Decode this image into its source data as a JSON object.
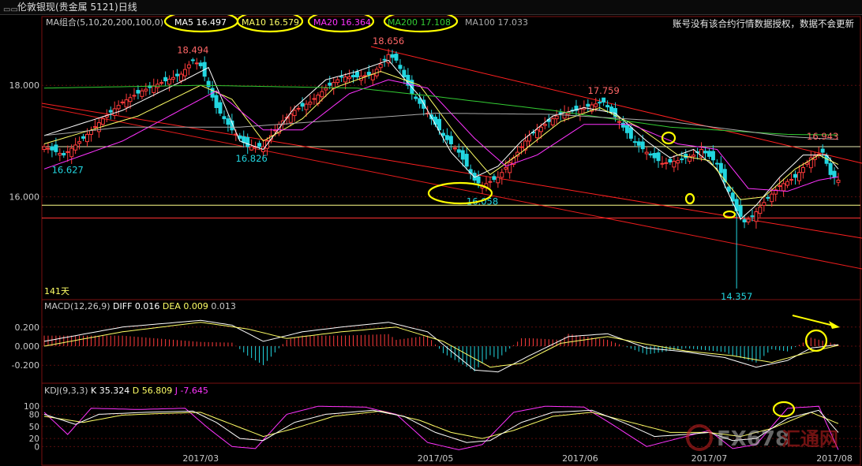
{
  "window": {
    "icon": "window-icon",
    "title": "伦敦银现(贵金属 5121)日线",
    "notice": "账号没有该合约行情数据授权，数据不会更新",
    "days_label": "141天"
  },
  "watermark": {
    "brand": "FX678",
    "cn": "汇通网"
  },
  "colors": {
    "bg": "#000000",
    "up": "#ff3b3b",
    "down": "#22d6e0",
    "ma5": "#ffffff",
    "ma10": "#ffff66",
    "ma20": "#ff33ff",
    "ma200": "#33cc33",
    "ma100": "#aaaaaa",
    "highlight": "#ffff00",
    "trend": "#ff2020"
  },
  "chart_data": [
    {
      "type": "candlestick",
      "panel": "price",
      "indicator_label": "MA组合(5,10,20,200,100,0)",
      "legend": [
        {
          "name": "MA5",
          "value": "16.497"
        },
        {
          "name": "MA10",
          "value": "16.579"
        },
        {
          "name": "MA20",
          "value": "16.364"
        },
        {
          "name": "MA200",
          "value": "17.108"
        },
        {
          "name": "MA100",
          "value": "17.033"
        }
      ],
      "ylim": [
        14.2,
        18.95
      ],
      "y_ticks": [
        "18.000",
        "16.000"
      ],
      "x_ticks": [
        "2017/03",
        "2017/05",
        "2017/06",
        "2017/07",
        "2017/08"
      ],
      "annotations": [
        {
          "text": "18.494",
          "value": 18.494
        },
        {
          "text": "18.656",
          "value": 18.656
        },
        {
          "text": "17.759",
          "value": 17.759
        },
        {
          "text": "16.943",
          "value": 16.943
        },
        {
          "text": "16.627",
          "value": 16.627
        },
        {
          "text": "16.826",
          "value": 16.826
        },
        {
          "text": "16.058",
          "value": 16.058
        },
        {
          "text": "14.357",
          "value": 14.357
        }
      ],
      "horizontal_levels": [
        16.9,
        15.85,
        15.62
      ],
      "ma_knots": {
        "ma5": [
          [
            0,
            17.1
          ],
          [
            20,
            17.55
          ],
          [
            36,
            18.1
          ],
          [
            42,
            18.32
          ],
          [
            50,
            17.0
          ],
          [
            56,
            16.85
          ],
          [
            64,
            17.6
          ],
          [
            72,
            18.1
          ],
          [
            80,
            18.25
          ],
          [
            88,
            18.45
          ],
          [
            96,
            17.8
          ],
          [
            104,
            16.8
          ],
          [
            110,
            16.35
          ],
          [
            116,
            16.55
          ],
          [
            122,
            17.0
          ],
          [
            130,
            17.45
          ],
          [
            138,
            17.6
          ],
          [
            146,
            17.5
          ],
          [
            154,
            17.0
          ],
          [
            160,
            16.7
          ],
          [
            166,
            16.85
          ],
          [
            172,
            16.5
          ],
          [
            176,
            15.9
          ],
          [
            178,
            15.6
          ],
          [
            182,
            15.85
          ],
          [
            188,
            16.35
          ],
          [
            194,
            16.75
          ],
          [
            200,
            16.75
          ],
          [
            203,
            16.5
          ]
        ],
        "ma10": [
          [
            0,
            16.95
          ],
          [
            24,
            17.45
          ],
          [
            40,
            18.0
          ],
          [
            48,
            17.75
          ],
          [
            56,
            17.0
          ],
          [
            66,
            17.4
          ],
          [
            74,
            17.95
          ],
          [
            86,
            18.25
          ],
          [
            96,
            18.0
          ],
          [
            106,
            17.05
          ],
          [
            114,
            16.4
          ],
          [
            122,
            16.8
          ],
          [
            132,
            17.35
          ],
          [
            142,
            17.6
          ],
          [
            152,
            17.25
          ],
          [
            162,
            16.75
          ],
          [
            170,
            16.65
          ],
          [
            178,
            15.95
          ],
          [
            184,
            16.0
          ],
          [
            192,
            16.5
          ],
          [
            198,
            16.75
          ],
          [
            203,
            16.58
          ]
        ],
        "ma20": [
          [
            0,
            16.5
          ],
          [
            20,
            17.0
          ],
          [
            44,
            17.9
          ],
          [
            56,
            17.2
          ],
          [
            66,
            17.2
          ],
          [
            78,
            17.85
          ],
          [
            88,
            18.1
          ],
          [
            98,
            17.95
          ],
          [
            110,
            17.05
          ],
          [
            118,
            16.55
          ],
          [
            126,
            16.75
          ],
          [
            138,
            17.3
          ],
          [
            150,
            17.3
          ],
          [
            162,
            16.95
          ],
          [
            172,
            16.85
          ],
          [
            180,
            16.15
          ],
          [
            190,
            16.1
          ],
          [
            198,
            16.3
          ],
          [
            203,
            16.36
          ]
        ],
        "ma200": [
          [
            0,
            17.95
          ],
          [
            40,
            18.0
          ],
          [
            80,
            17.95
          ],
          [
            100,
            17.8
          ],
          [
            130,
            17.55
          ],
          [
            160,
            17.25
          ],
          [
            190,
            17.12
          ],
          [
            203,
            17.11
          ]
        ],
        "ma100": [
          [
            0,
            17.1
          ],
          [
            20,
            17.25
          ],
          [
            50,
            17.25
          ],
          [
            80,
            17.4
          ],
          [
            100,
            17.5
          ],
          [
            130,
            17.48
          ],
          [
            160,
            17.35
          ],
          [
            190,
            17.08
          ],
          [
            203,
            17.03
          ]
        ]
      },
      "close_knots": [
        [
          0,
          16.9
        ],
        [
          5,
          16.75
        ],
        [
          10,
          17.05
        ],
        [
          15,
          17.4
        ],
        [
          20,
          17.7
        ],
        [
          25,
          17.9
        ],
        [
          30,
          18.05
        ],
        [
          35,
          18.2
        ],
        [
          38,
          18.45
        ],
        [
          40,
          18.35
        ],
        [
          44,
          17.6
        ],
        [
          48,
          17.2
        ],
        [
          52,
          16.9
        ],
        [
          56,
          16.9
        ],
        [
          60,
          17.3
        ],
        [
          64,
          17.55
        ],
        [
          68,
          17.7
        ],
        [
          72,
          17.95
        ],
        [
          76,
          18.15
        ],
        [
          80,
          18.15
        ],
        [
          84,
          18.2
        ],
        [
          88,
          18.55
        ],
        [
          90,
          18.45
        ],
        [
          94,
          17.85
        ],
        [
          98,
          17.5
        ],
        [
          102,
          17.1
        ],
        [
          106,
          16.8
        ],
        [
          110,
          16.3
        ],
        [
          112,
          16.2
        ],
        [
          116,
          16.35
        ],
        [
          120,
          16.7
        ],
        [
          124,
          17.1
        ],
        [
          128,
          17.3
        ],
        [
          132,
          17.5
        ],
        [
          136,
          17.55
        ],
        [
          140,
          17.65
        ],
        [
          143,
          17.7
        ],
        [
          147,
          17.35
        ],
        [
          150,
          17.05
        ],
        [
          154,
          16.8
        ],
        [
          158,
          16.6
        ],
        [
          162,
          16.65
        ],
        [
          166,
          16.75
        ],
        [
          168,
          16.85
        ],
        [
          172,
          16.6
        ],
        [
          175,
          16.1
        ],
        [
          177,
          15.75
        ],
        [
          179,
          15.55
        ],
        [
          181,
          15.65
        ],
        [
          184,
          15.9
        ],
        [
          188,
          16.2
        ],
        [
          192,
          16.35
        ],
        [
          196,
          16.7
        ],
        [
          199,
          16.8
        ],
        [
          201,
          16.4
        ],
        [
          203,
          16.3
        ]
      ],
      "bars": 204
    },
    {
      "type": "bar-line",
      "panel": "macd",
      "indicator_label": "MACD(12,26,9)",
      "legend": [
        {
          "name": "DIFF",
          "value": "0.016"
        },
        {
          "name": "DEA",
          "value": "0.009"
        },
        {
          "name": "",
          "value": "0.013"
        }
      ],
      "ylim": [
        -0.33,
        0.33
      ],
      "y_ticks": [
        0.2,
        0.0,
        -0.2
      ],
      "y_tick_labels": [
        "0.200",
        "0.000",
        "-0.200"
      ],
      "diff_knots": [
        [
          0,
          0.05
        ],
        [
          20,
          0.2
        ],
        [
          40,
          0.27
        ],
        [
          48,
          0.22
        ],
        [
          56,
          0.05
        ],
        [
          66,
          0.15
        ],
        [
          76,
          0.2
        ],
        [
          88,
          0.25
        ],
        [
          98,
          0.15
        ],
        [
          110,
          -0.25
        ],
        [
          116,
          -0.27
        ],
        [
          124,
          -0.1
        ],
        [
          134,
          0.1
        ],
        [
          144,
          0.13
        ],
        [
          154,
          -0.02
        ],
        [
          164,
          -0.06
        ],
        [
          174,
          -0.12
        ],
        [
          182,
          -0.22
        ],
        [
          190,
          -0.15
        ],
        [
          196,
          -0.02
        ],
        [
          203,
          0.016
        ]
      ],
      "dea_knots": [
        [
          0,
          0.0
        ],
        [
          20,
          0.15
        ],
        [
          40,
          0.25
        ],
        [
          52,
          0.18
        ],
        [
          62,
          0.08
        ],
        [
          76,
          0.15
        ],
        [
          90,
          0.2
        ],
        [
          102,
          0.05
        ],
        [
          114,
          -0.22
        ],
        [
          122,
          -0.18
        ],
        [
          132,
          0.03
        ],
        [
          144,
          0.1
        ],
        [
          154,
          0.02
        ],
        [
          164,
          -0.05
        ],
        [
          176,
          -0.1
        ],
        [
          186,
          -0.17
        ],
        [
          194,
          -0.08
        ],
        [
          203,
          0.009
        ]
      ]
    },
    {
      "type": "line",
      "panel": "kdj",
      "indicator_label": "KDJ(9,3,3)",
      "legend": [
        {
          "name": "K",
          "value": "35.324"
        },
        {
          "name": "D",
          "value": "56.809"
        },
        {
          "name": "J",
          "value": "-7.645"
        }
      ],
      "ylim": [
        -15,
        120
      ],
      "y_ticks": [
        100,
        80,
        50,
        20,
        0
      ],
      "y_tick_labels": [
        "100",
        "80",
        "50",
        "20",
        "0"
      ],
      "k_knots": [
        [
          0,
          80
        ],
        [
          8,
          55
        ],
        [
          14,
          80
        ],
        [
          26,
          85
        ],
        [
          38,
          88
        ],
        [
          44,
          60
        ],
        [
          50,
          20
        ],
        [
          56,
          15
        ],
        [
          64,
          60
        ],
        [
          72,
          80
        ],
        [
          84,
          90
        ],
        [
          92,
          75
        ],
        [
          100,
          35
        ],
        [
          108,
          10
        ],
        [
          114,
          15
        ],
        [
          122,
          60
        ],
        [
          130,
          85
        ],
        [
          140,
          90
        ],
        [
          148,
          60
        ],
        [
          156,
          25
        ],
        [
          164,
          30
        ],
        [
          170,
          35
        ],
        [
          176,
          15
        ],
        [
          182,
          20
        ],
        [
          190,
          70
        ],
        [
          198,
          90
        ],
        [
          203,
          35
        ]
      ],
      "d_knots": [
        [
          0,
          75
        ],
        [
          10,
          60
        ],
        [
          20,
          78
        ],
        [
          30,
          82
        ],
        [
          40,
          85
        ],
        [
          48,
          55
        ],
        [
          56,
          25
        ],
        [
          64,
          45
        ],
        [
          74,
          75
        ],
        [
          86,
          88
        ],
        [
          96,
          65
        ],
        [
          104,
          35
        ],
        [
          112,
          20
        ],
        [
          120,
          40
        ],
        [
          130,
          75
        ],
        [
          140,
          85
        ],
        [
          150,
          60
        ],
        [
          160,
          35
        ],
        [
          170,
          35
        ],
        [
          178,
          25
        ],
        [
          186,
          45
        ],
        [
          196,
          85
        ],
        [
          203,
          57
        ]
      ],
      "j_knots": [
        [
          0,
          85
        ],
        [
          6,
          30
        ],
        [
          12,
          95
        ],
        [
          24,
          92
        ],
        [
          36,
          95
        ],
        [
          42,
          45
        ],
        [
          48,
          0
        ],
        [
          54,
          -5
        ],
        [
          62,
          80
        ],
        [
          70,
          100
        ],
        [
          82,
          98
        ],
        [
          90,
          80
        ],
        [
          98,
          10
        ],
        [
          106,
          -8
        ],
        [
          112,
          5
        ],
        [
          120,
          85
        ],
        [
          128,
          100
        ],
        [
          138,
          98
        ],
        [
          146,
          50
        ],
        [
          154,
          0
        ],
        [
          162,
          20
        ],
        [
          170,
          40
        ],
        [
          176,
          -5
        ],
        [
          182,
          5
        ],
        [
          190,
          95
        ],
        [
          198,
          100
        ],
        [
          203,
          -8
        ]
      ]
    }
  ]
}
